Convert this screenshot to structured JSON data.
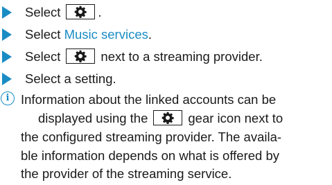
{
  "steps": [
    {
      "pre": "Select",
      "post": "."
    },
    {
      "pre": "Select",
      "link": "Music services",
      "post": "."
    },
    {
      "pre": "Select",
      "post": "next to a streaming provider."
    },
    {
      "pre": "Select a setting.",
      "post": ""
    }
  ],
  "info": {
    "lines": [
      {
        "text": "Information about the linked accounts can be"
      },
      {
        "pre": "displayed using the",
        "post": "gear icon next to"
      },
      {
        "text": "the configured streaming provider. The availa-"
      },
      {
        "text": "ble information depends on what is offered by"
      },
      {
        "text": "the provider of the streaming service."
      }
    ],
    "icon_glyph": "i"
  },
  "icons": {
    "step_marker": "triangle-arrow-icon",
    "settings": "gear-icon",
    "info": "info-icon"
  },
  "colors": {
    "accent": "#1a8cc4",
    "text": "#1a1a1a"
  }
}
